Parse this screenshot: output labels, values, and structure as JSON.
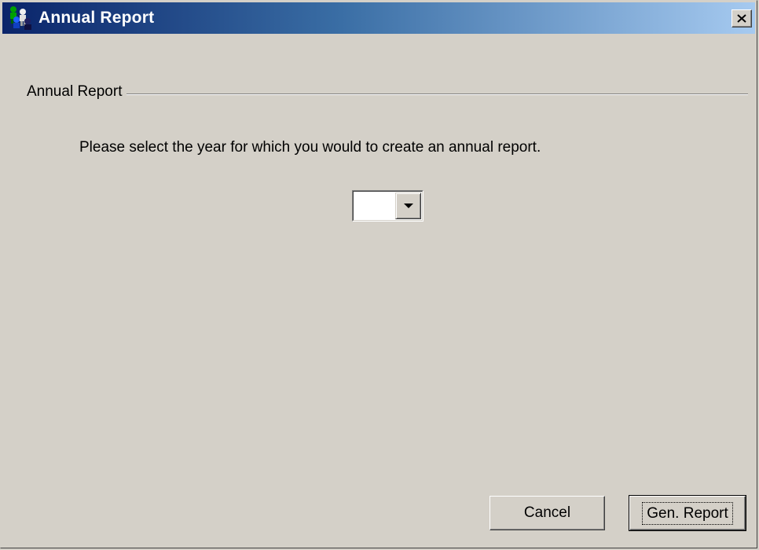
{
  "window": {
    "title": "Annual Report",
    "close_glyph": "×"
  },
  "icons": {
    "app_icon": "people-app-icon",
    "close_icon": "close-icon",
    "dropdown_icon": "chevron-down-icon"
  },
  "group": {
    "label": "Annual Report"
  },
  "prompt": {
    "text": "Please select the year for which you would to create an annual report."
  },
  "year_select": {
    "value": ""
  },
  "buttons": {
    "cancel_label": "Cancel",
    "generate_label": "Gen. Report"
  },
  "colors": {
    "titlebar_start": "#0a246a",
    "titlebar_end": "#a6caf0",
    "face": "#d4d0c8"
  }
}
